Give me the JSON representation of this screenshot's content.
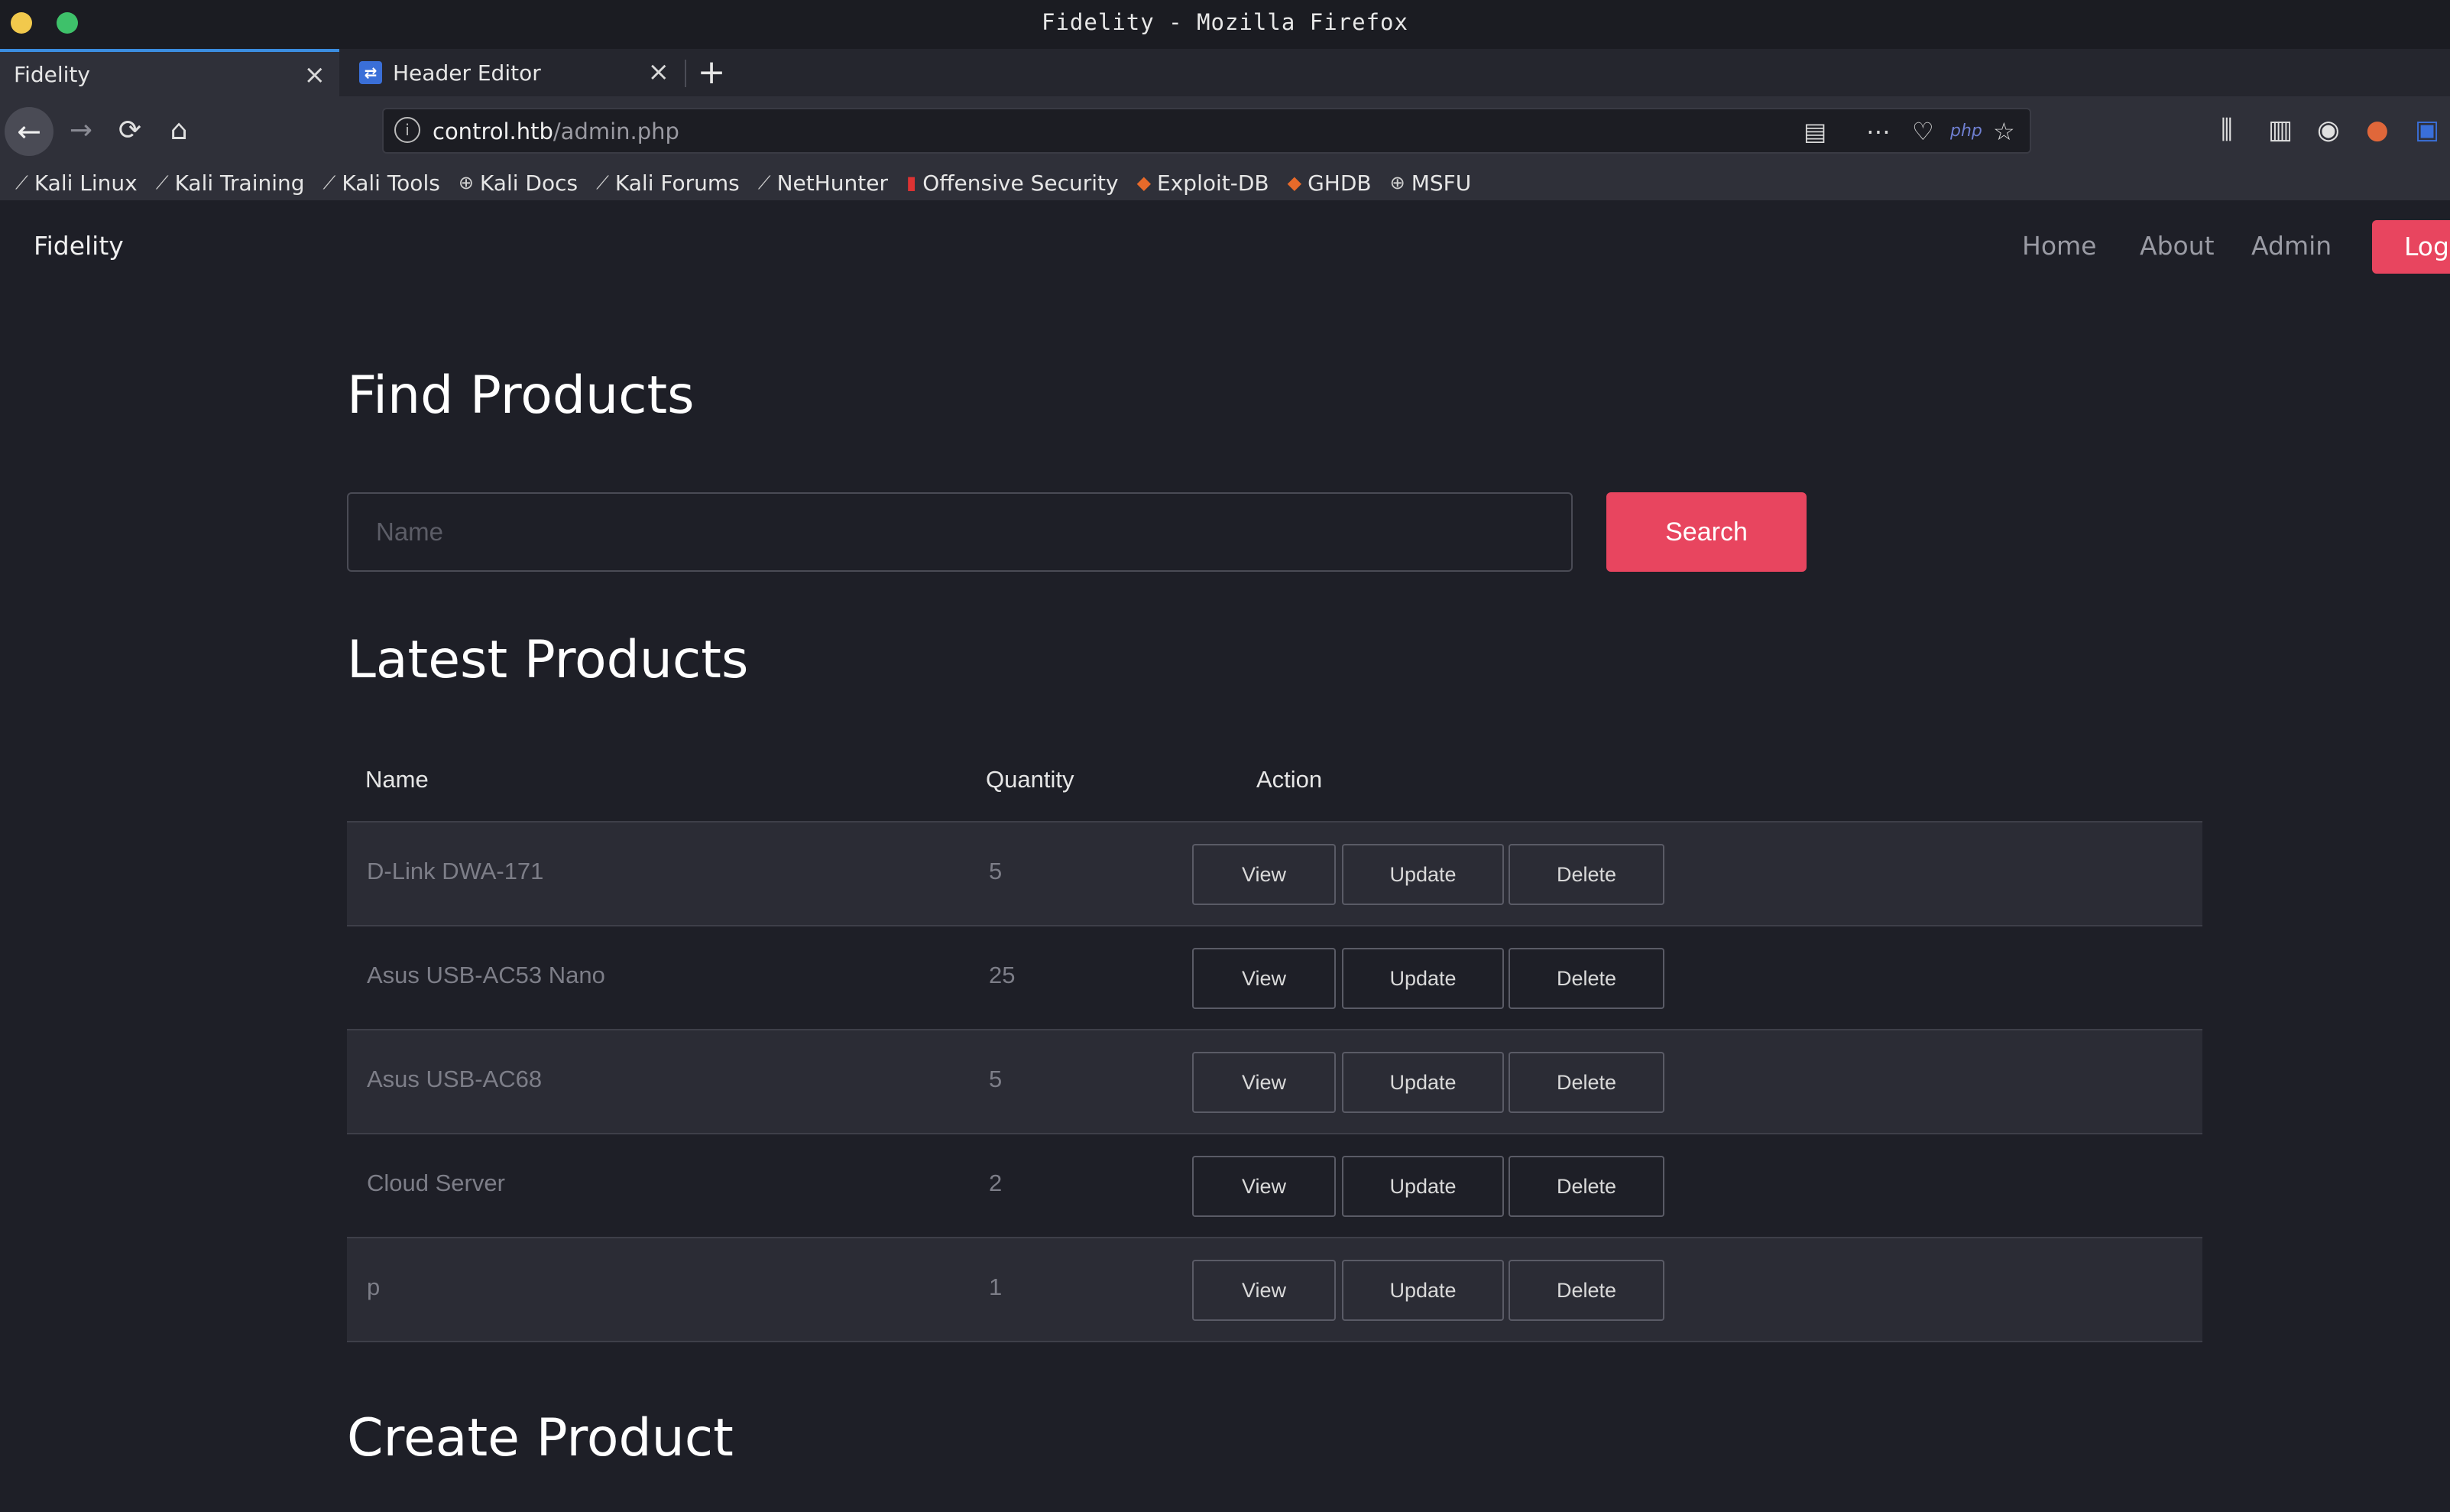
{
  "window": {
    "title": "Fidelity - Mozilla Firefox"
  },
  "tabs": [
    {
      "label": "Fidelity",
      "active": true
    },
    {
      "label": "Header Editor",
      "active": false
    }
  ],
  "address_bar": {
    "host": "control.htb",
    "path": "/admin.php"
  },
  "bookmarks": [
    {
      "label": "Kali Linux",
      "icon": "kali-dragon-icon"
    },
    {
      "label": "Kali Training",
      "icon": "kali-dragon-icon"
    },
    {
      "label": "Kali Tools",
      "icon": "kali-dragon-icon"
    },
    {
      "label": "Kali Docs",
      "icon": "globe-icon"
    },
    {
      "label": "Kali Forums",
      "icon": "kali-dragon-icon"
    },
    {
      "label": "NetHunter",
      "icon": "kali-dragon-icon"
    },
    {
      "label": "Offensive Security",
      "icon": "offsec-icon"
    },
    {
      "label": "Exploit-DB",
      "icon": "exploitdb-icon"
    },
    {
      "label": "GHDB",
      "icon": "exploitdb-icon"
    },
    {
      "label": "MSFU",
      "icon": "globe-icon"
    }
  ],
  "site": {
    "brand": "Fidelity",
    "nav": {
      "home": "Home",
      "about": "About",
      "admin": "Admin",
      "login": "Log"
    }
  },
  "find": {
    "title": "Find Products",
    "placeholder": "Name",
    "button": "Search"
  },
  "latest": {
    "title": "Latest Products",
    "columns": {
      "name": "Name",
      "quantity": "Quantity",
      "action": "Action"
    },
    "rows": [
      {
        "name": "D-Link DWA-171",
        "quantity": "5"
      },
      {
        "name": "Asus USB-AC53 Nano",
        "quantity": "25"
      },
      {
        "name": "Asus USB-AC68",
        "quantity": "5"
      },
      {
        "name": "Cloud Server",
        "quantity": "2"
      },
      {
        "name": "p",
        "quantity": "1"
      }
    ],
    "actions": {
      "view": "View",
      "update": "Update",
      "delete": "Delete"
    }
  },
  "create": {
    "title": "Create Product"
  },
  "colors": {
    "accent": "#e8455f",
    "background": "#1e1f27",
    "tab_highlight": "#3b8de0"
  }
}
